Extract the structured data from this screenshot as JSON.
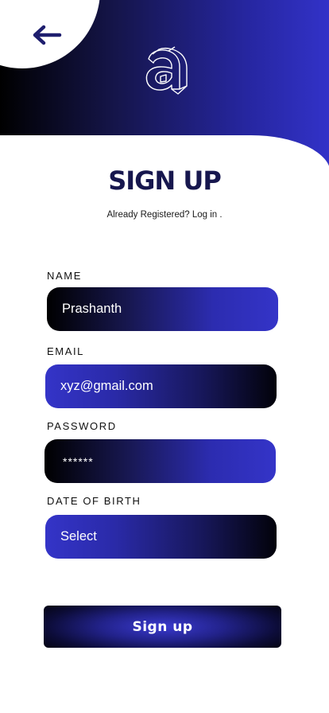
{
  "header": {
    "back_icon": "arrow-left-icon",
    "logo_icon": "letter-a-logo-icon"
  },
  "title": "SIGN UP",
  "login_prompt": "Already Registered? Log in .",
  "form": {
    "name": {
      "label": "NAME",
      "value": "Prashanth"
    },
    "email": {
      "label": "EMAIL",
      "value": "xyz@gmail.com"
    },
    "password": {
      "label": "PASSWORD",
      "value": "******"
    },
    "dob": {
      "label": "DATE OF BIRTH",
      "value": "Select"
    }
  },
  "signup_button": "Sign up",
  "colors": {
    "title": "#17174e",
    "accent_blue": "#3434c8",
    "dark": "#000000",
    "back_arrow": "#1e1e6e"
  }
}
